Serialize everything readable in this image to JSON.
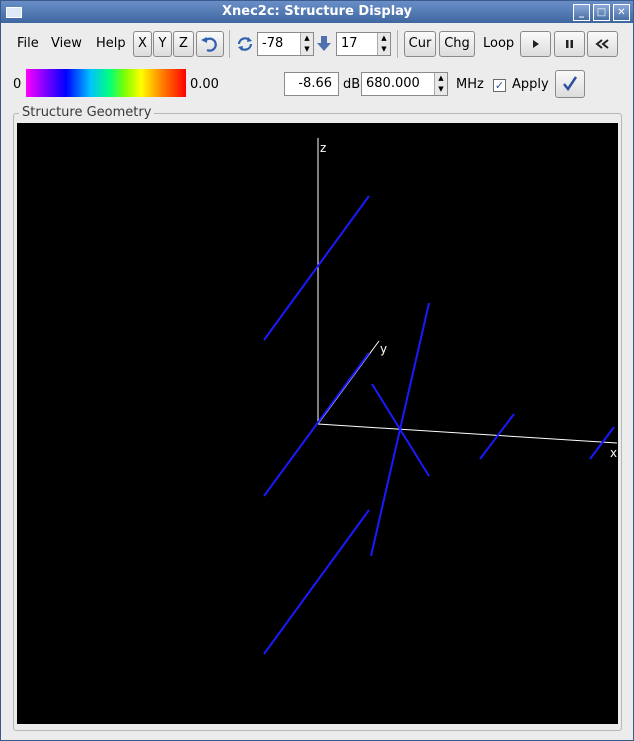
{
  "window": {
    "title": "Xnec2c: Structure Display"
  },
  "menu": {
    "file": "File",
    "view": "View",
    "help": "Help"
  },
  "toolbar": {
    "x_label": "X",
    "y_label": "Y",
    "z_label": "Z",
    "rotate_value": "-78",
    "incline_value": "17",
    "cur_label": "Cur",
    "chg_label": "Chg",
    "loop_label": "Loop"
  },
  "colorbar": {
    "min_label": "0",
    "max_label": "0.00"
  },
  "gain": {
    "value": "-8.66",
    "unit": "dB"
  },
  "frequency": {
    "value": "680.000",
    "unit": "MHz"
  },
  "apply": {
    "label": "Apply",
    "checked": true
  },
  "frame": {
    "title": "Structure Geometry"
  },
  "axes": {
    "x": "x",
    "y": "y",
    "z": "z"
  },
  "colors": {
    "wire": "#1a1aff",
    "axis": "#ffffff",
    "canvas": "#000000"
  }
}
